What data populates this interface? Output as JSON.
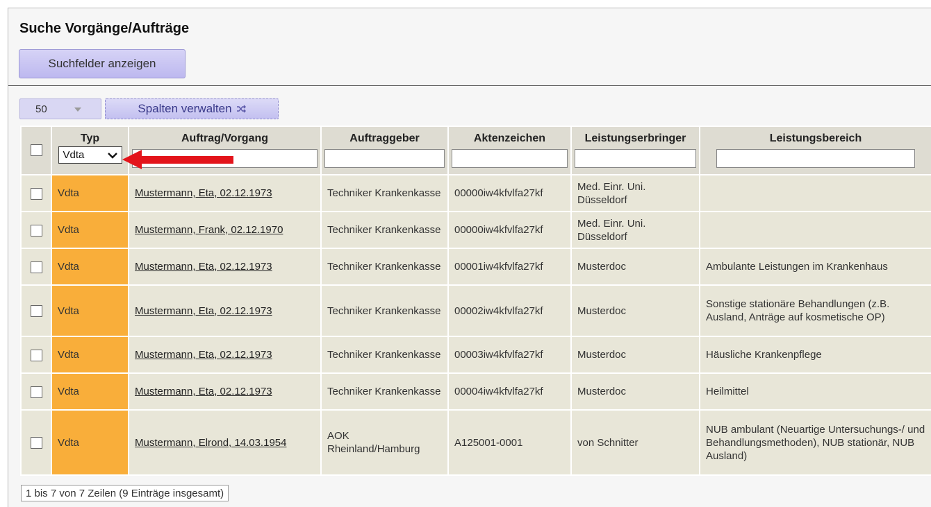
{
  "page": {
    "title": "Suche Vorgänge/Aufträge",
    "search_fields_button": "Suchfelder anzeigen",
    "page_size": "50",
    "manage_columns_button": "Spalten verwalten",
    "manage_columns_icon": "shuffle-icon",
    "footer": "1 bis 7 von 7 Zeilen (9 Einträge insgesamt)"
  },
  "table": {
    "headers": [
      "Typ",
      "Auftrag/Vorgang",
      "Auftraggeber",
      "Aktenzeichen",
      "Leistungserbringer",
      "Leistungsbereich"
    ],
    "type_filter_value": "Vdta",
    "type_color": "#f9ae3a",
    "rows": [
      {
        "typ": "Vdta",
        "auftrag": "Mustermann, Eta, 02.12.1973",
        "auftraggeber": "Techniker Krankenkasse",
        "aktenzeichen": "00000iw4kfvlfa27kf",
        "leistungserbringer": "Med. Einr. Uni. Düsseldorf",
        "leistungsbereich": ""
      },
      {
        "typ": "Vdta",
        "auftrag": "Mustermann, Frank, 02.12.1970",
        "auftraggeber": "Techniker Krankenkasse",
        "aktenzeichen": "00000iw4kfvlfa27kf",
        "leistungserbringer": "Med. Einr. Uni. Düsseldorf",
        "leistungsbereich": ""
      },
      {
        "typ": "Vdta",
        "auftrag": "Mustermann, Eta, 02.12.1973",
        "auftraggeber": "Techniker Krankenkasse",
        "aktenzeichen": "00001iw4kfvlfa27kf",
        "leistungserbringer": "Musterdoc",
        "leistungsbereich": "Ambulante Leistungen im Krankenhaus"
      },
      {
        "typ": "Vdta",
        "auftrag": "Mustermann, Eta, 02.12.1973",
        "auftraggeber": "Techniker Krankenkasse",
        "aktenzeichen": "00002iw4kfvlfa27kf",
        "leistungserbringer": "Musterdoc",
        "leistungsbereich": "Sonstige stationäre Behandlungen (z.B. Ausland, Anträge auf kosmetische OP)"
      },
      {
        "typ": "Vdta",
        "auftrag": "Mustermann, Eta, 02.12.1973",
        "auftraggeber": "Techniker Krankenkasse",
        "aktenzeichen": "00003iw4kfvlfa27kf",
        "leistungserbringer": "Musterdoc",
        "leistungsbereich": "Häusliche Krankenpflege"
      },
      {
        "typ": "Vdta",
        "auftrag": "Mustermann, Eta, 02.12.1973",
        "auftraggeber": "Techniker Krankenkasse",
        "aktenzeichen": "00004iw4kfvlfa27kf",
        "leistungserbringer": "Musterdoc",
        "leistungsbereich": "Heilmittel"
      },
      {
        "typ": "Vdta",
        "auftrag": "Mustermann, Elrond, 14.03.1954",
        "auftraggeber": "AOK Rheinland/Hamburg",
        "aktenzeichen": "A125001-0001",
        "leistungserbringer": "von Schnitter",
        "leistungsbereich": "NUB ambulant (Neuartige Untersuchungs-/ und Behandlungsmethoden), NUB stationär, NUB Ausland)"
      }
    ]
  },
  "annotation": {
    "arrow_color": "#e3141b",
    "arrow_icon": "red-arrow-left-icon"
  }
}
